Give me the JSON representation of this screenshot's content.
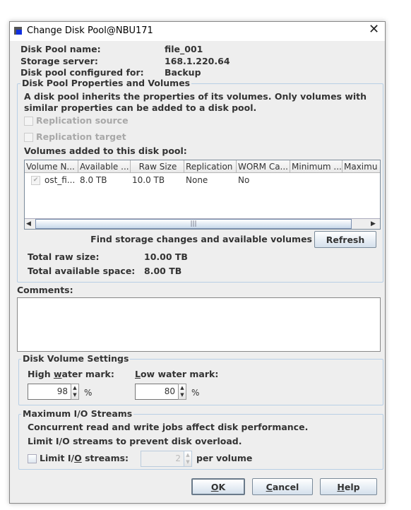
{
  "window": {
    "title": "Change Disk Pool@NBU171",
    "icon": "app-window-icon",
    "close": "close-icon"
  },
  "info": [
    {
      "label": "Disk Pool name:",
      "value": "file_001"
    },
    {
      "label": "Storage server:",
      "value": "168.1.220.64"
    },
    {
      "label": "Disk pool configured for:",
      "value": "Backup"
    }
  ],
  "properties": {
    "title": "Disk Pool Properties and Volumes",
    "desc1": "A disk pool inherits the properties of its volumes. Only volumes with",
    "desc2": "similar properties can be added to a disk pool.",
    "replication_source": "Replication source",
    "replication_target": "Replication target",
    "volumes_label": "Volumes added to this disk pool:",
    "columns": [
      "Volume N...",
      "Available ...",
      "Raw Size",
      "Replication",
      "WORM Ca...",
      "Minimum ...",
      "Maximu"
    ],
    "rows": [
      {
        "checked": true,
        "cells": [
          "ost_fi...",
          "8.0 TB",
          "10.0 TB",
          "None",
          "No",
          "",
          ""
        ]
      }
    ],
    "find_text": "Find storage changes and available volumes",
    "refresh": "Refresh",
    "total_raw_label": "Total raw size:",
    "total_raw": "10.00 TB",
    "total_avail_label": "Total available space:",
    "total_avail": "8.00 TB"
  },
  "comments": {
    "label": "Comments:",
    "value": ""
  },
  "volume_settings": {
    "title": "Disk Volume Settings",
    "high": {
      "pre": "High ",
      "mn": "w",
      "post": "ater mark:",
      "value": "98",
      "unit": "%"
    },
    "low": {
      "pre": "",
      "mn": "L",
      "post": "ow water mark:",
      "value": "80",
      "unit": "%"
    }
  },
  "io": {
    "title": "Maximum I/O Streams",
    "line1": "Concurrent read and write jobs affect disk performance.",
    "line2": "Limit I/O streams to prevent disk overload.",
    "limit": {
      "pre": "Limit I/",
      "mn": "O",
      "post": " streams:",
      "checked": false
    },
    "value": "2",
    "unit": "per volume"
  },
  "buttons": {
    "ok": {
      "mn": "O",
      "post": "K"
    },
    "cancel": {
      "mn": "C",
      "post": "ancel"
    },
    "help": {
      "mn": "H",
      "post": "elp"
    }
  }
}
